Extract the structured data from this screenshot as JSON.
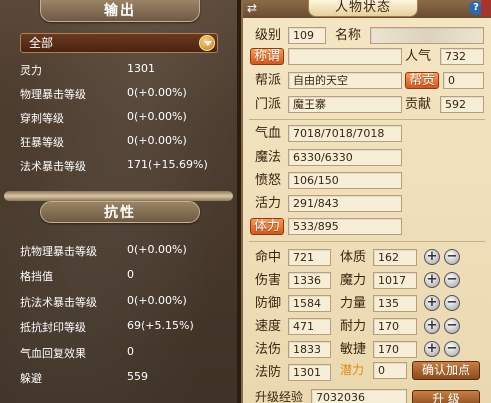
{
  "left_panel": {
    "output_header": "输出",
    "filter_selected": "全部",
    "output_stats": [
      {
        "label": "灵力",
        "value": "1301"
      },
      {
        "label": "物理暴击等级",
        "value": "0(+0.00%)"
      },
      {
        "label": "穿刺等级",
        "value": "0(+0.00%)"
      },
      {
        "label": "狂暴等级",
        "value": "0(+0.00%)"
      },
      {
        "label": "法术暴击等级",
        "value": "171(+15.69%)"
      }
    ],
    "resist_header": "抗性",
    "resist_stats": [
      {
        "label": "抗物理暴击等级",
        "value": "0(+0.00%)"
      },
      {
        "label": "格挡值",
        "value": "0"
      },
      {
        "label": "抗法术暴击等级",
        "value": "0(+0.00%)"
      },
      {
        "label": "抵抗封印等级",
        "value": "69(+5.15%)"
      },
      {
        "label": "气血回复效果",
        "value": "0"
      },
      {
        "label": "躲避",
        "value": "559"
      }
    ]
  },
  "right_panel": {
    "title": "人物状态",
    "level_label": "级别",
    "level_value": "109",
    "name_label": "名称",
    "title_button": "称谓",
    "popularity_label": "人气",
    "popularity_value": "732",
    "faction_label": "帮派",
    "faction_value": "自由的天空",
    "faction_contrib_button": "帮贡",
    "faction_contrib_value": "0",
    "sect_label": "门派",
    "sect_value": "魔王寨",
    "contribution_label": "贡献",
    "contribution_value": "592",
    "hp_label": "气血",
    "hp_value": "7018/7018/7018",
    "mp_label": "魔法",
    "mp_value": "6330/6330",
    "anger_label": "愤怒",
    "anger_value": "106/150",
    "vitality_label": "活力",
    "vitality_value": "291/843",
    "stamina_button": "体力",
    "stamina_value": "533/895",
    "attrs_left": [
      {
        "label": "命中",
        "value": "721"
      },
      {
        "label": "伤害",
        "value": "1336"
      },
      {
        "label": "防御",
        "value": "1584"
      },
      {
        "label": "速度",
        "value": "471"
      },
      {
        "label": "法伤",
        "value": "1833"
      },
      {
        "label": "法防",
        "value": "1301"
      }
    ],
    "attrs_right": [
      {
        "label": "体质",
        "value": "162"
      },
      {
        "label": "魔力",
        "value": "1017"
      },
      {
        "label": "力量",
        "value": "135"
      },
      {
        "label": "耐力",
        "value": "170"
      },
      {
        "label": "敏捷",
        "value": "170"
      }
    ],
    "plus_symbol": "+",
    "minus_symbol": "−",
    "potential_label": "潜力",
    "potential_value": "0",
    "confirm_button": "确认加点",
    "exp_label": "升级经验",
    "exp_value": "7032036",
    "upgrade_button": "升 级"
  }
}
